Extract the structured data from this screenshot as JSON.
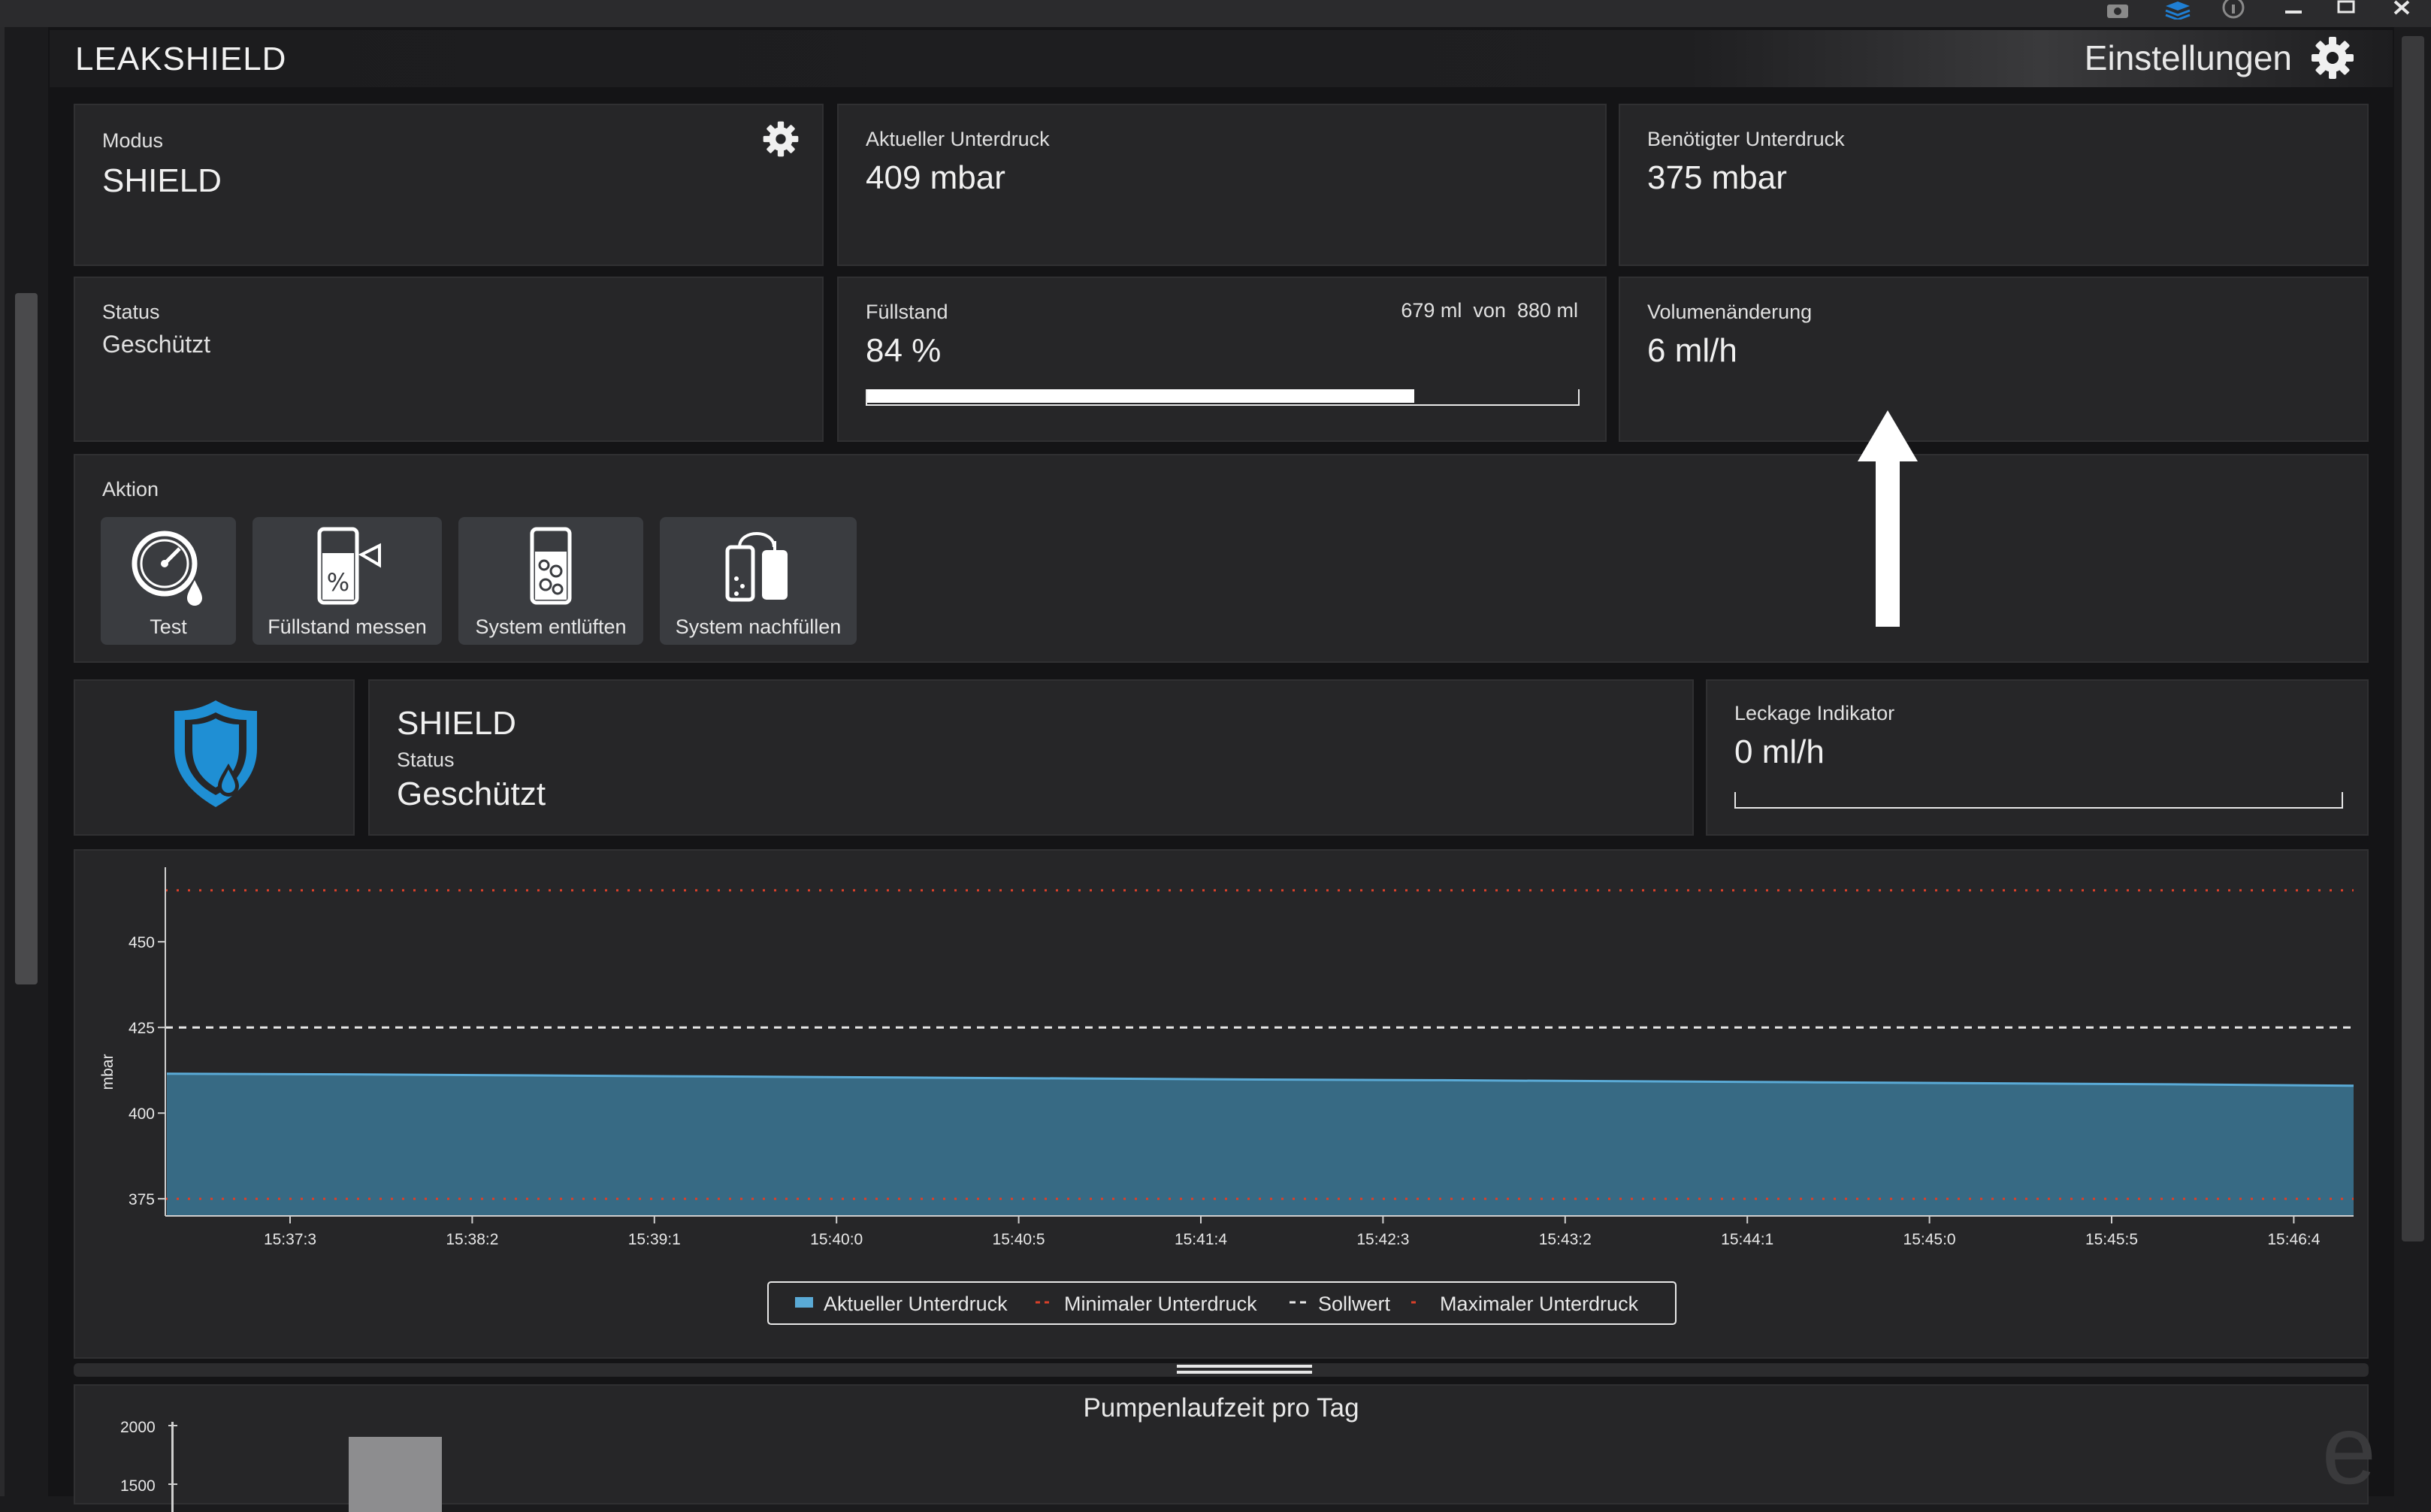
{
  "window": {
    "controls": [
      "camera-icon",
      "layers-icon",
      "info-icon",
      "minimize-icon",
      "maximize-icon",
      "close-icon"
    ]
  },
  "header": {
    "title": "LEAKSHIELD",
    "settings_label": "Einstellungen"
  },
  "cards": {
    "mode": {
      "label": "Modus",
      "value": "SHIELD"
    },
    "current_vacuum": {
      "label": "Aktueller Unterdruck",
      "value": "409 mbar"
    },
    "required_vacuum": {
      "label": "Benötigter Unterdruck",
      "value": "375 mbar"
    },
    "status": {
      "label": "Status",
      "value": "Geschützt"
    },
    "fill": {
      "label": "Füllstand",
      "value": "84 %",
      "amount": "679 ml",
      "of": "von",
      "capacity": "880 ml",
      "fraction": 0.77
    },
    "volume_change": {
      "label": "Volumenänderung",
      "value": "6 ml/h"
    }
  },
  "actions": {
    "title": "Aktion",
    "buttons": [
      {
        "label": "Test",
        "icon": "gauge-drop-icon"
      },
      {
        "label": "Füllstand messen",
        "icon": "fill-level-icon"
      },
      {
        "label": "System entlüften",
        "icon": "bubbles-icon"
      },
      {
        "label": "System nachfüllen",
        "icon": "refill-icon"
      }
    ]
  },
  "shield_status": {
    "title": "SHIELD",
    "status_label": "Status",
    "status_value": "Geschützt"
  },
  "leak": {
    "label": "Leckage Indikator",
    "value": "0 ml/h",
    "fraction": 0
  },
  "colors": {
    "area_fill": "#376a84",
    "area_line": "#5aaad6",
    "min_line": "#d9402a",
    "max_line": "#d9402a",
    "setpoint_line": "#e8e8e8",
    "shield_icon": "#1f8fd4"
  },
  "chart_data": {
    "type": "area",
    "ylabel": "mbar",
    "ylim": [
      370,
      470
    ],
    "yticks": [
      375,
      400,
      425,
      450
    ],
    "xticks": [
      "15:37:3",
      "15:38:2",
      "15:39:1",
      "15:40:0",
      "15:40:5",
      "15:41:4",
      "15:42:3",
      "15:43:2",
      "15:44:1",
      "15:45:0",
      "15:45:5",
      "15:46:4"
    ],
    "series": [
      {
        "name": "Aktueller Unterdruck",
        "kind": "area",
        "values": [
          411.5,
          411.3,
          411.0,
          410.7,
          410.4,
          410.1,
          409.8,
          409.6,
          409.3,
          409.0,
          408.7,
          408.4,
          408.0
        ]
      },
      {
        "name": "Minimaler Unterdruck",
        "kind": "line",
        "value": 375
      },
      {
        "name": "Sollwert",
        "kind": "line",
        "value": 425
      },
      {
        "name": "Maximaler Unterdruck",
        "kind": "line",
        "value": 465
      }
    ],
    "legend": [
      "Aktueller Unterdruck",
      "Minimaler Unterdruck",
      "Sollwert",
      "Maximaler Unterdruck"
    ],
    "legend_position": "bottom"
  },
  "pump_chart": {
    "type": "bar",
    "title": "Pumpenlaufzeit pro Tag",
    "yticks": [
      "2000",
      "1500"
    ]
  }
}
